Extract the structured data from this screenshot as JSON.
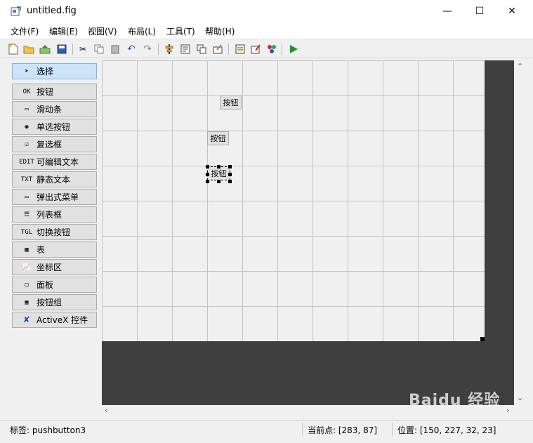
{
  "window": {
    "title": "untitled.fig",
    "minimize": "—",
    "maximize": "☐",
    "close": "✕"
  },
  "menu": [
    "文件(F)",
    "编辑(E)",
    "视图(V)",
    "布局(L)",
    "工具(T)",
    "帮助(H)"
  ],
  "toolbar": [
    "new-file-icon",
    "open-folder-icon",
    "export-icon",
    "save-icon",
    "cut-icon",
    "copy-icon",
    "paste-icon",
    "undo-icon",
    "redo-icon",
    "align-icon",
    "menu-editor-icon",
    "tab-order-icon",
    "toolbar-editor-icon",
    "mfile-editor-icon",
    "property-inspector-icon",
    "object-browser-icon",
    "run-icon"
  ],
  "palette": [
    {
      "label": "选择",
      "icon": "pointer-icon",
      "glyph": "➤",
      "active": true
    },
    {
      "label": "按钮",
      "icon": "pushbutton-icon",
      "glyph": "OK"
    },
    {
      "label": "滑动条",
      "icon": "slider-icon",
      "glyph": "▭"
    },
    {
      "label": "单选按钮",
      "icon": "radio-icon",
      "glyph": "◉"
    },
    {
      "label": "复选框",
      "icon": "checkbox-icon",
      "glyph": "☑"
    },
    {
      "label": "可编辑文本",
      "icon": "edit-text-icon",
      "glyph": "EDIT"
    },
    {
      "label": "静态文本",
      "icon": "static-text-icon",
      "glyph": "TXT"
    },
    {
      "label": "弹出式菜单",
      "icon": "popup-menu-icon",
      "glyph": "▭"
    },
    {
      "label": "列表框",
      "icon": "listbox-icon",
      "glyph": "☰"
    },
    {
      "label": "切换按钮",
      "icon": "toggle-button-icon",
      "glyph": "TGL"
    },
    {
      "label": "表",
      "icon": "table-icon",
      "glyph": "▦"
    },
    {
      "label": "坐标区",
      "icon": "axes-icon",
      "glyph": "📈"
    },
    {
      "label": "面板",
      "icon": "panel-icon",
      "glyph": "▢"
    },
    {
      "label": "按钮组",
      "icon": "button-group-icon",
      "glyph": "▣"
    },
    {
      "label": "ActiveX 控件",
      "icon": "activex-icon",
      "glyph": "✘"
    }
  ],
  "figure_buttons": [
    {
      "label": "按钮",
      "selected": false
    },
    {
      "label": "按钮",
      "selected": false
    },
    {
      "label": "按钮",
      "selected": true
    }
  ],
  "status": {
    "tag": "标签: pushbutton3",
    "current_point": "当前点:  [283, 87]",
    "position": "位置: [150, 227, 32, 23]"
  },
  "watermark": "Baidu 经验"
}
